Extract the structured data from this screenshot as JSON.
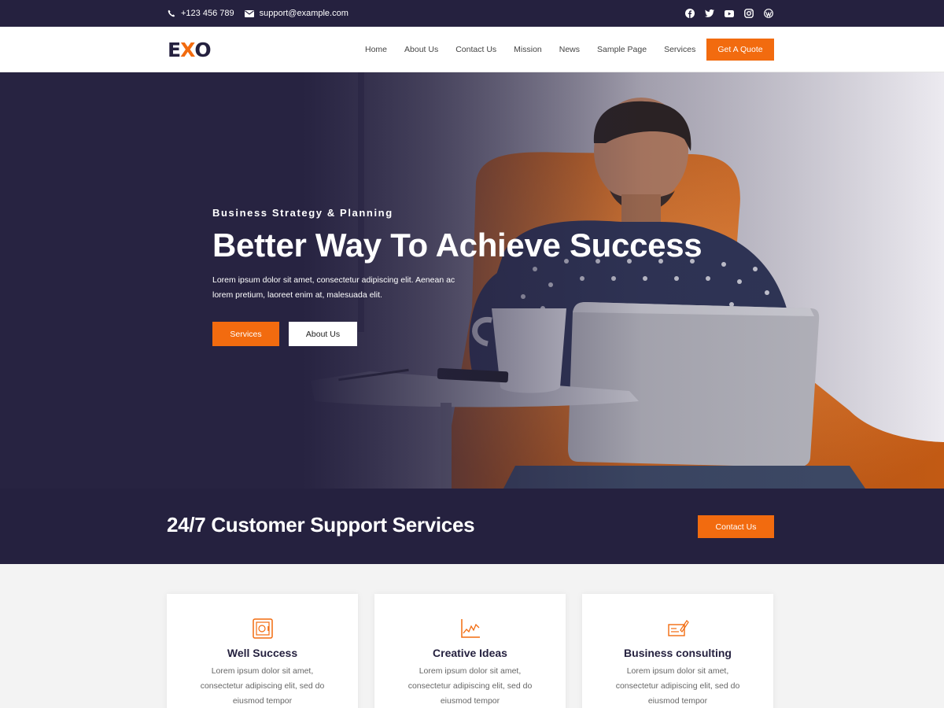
{
  "topbar": {
    "phone": "+123 456 789",
    "email": "support@example.com",
    "social_icons": [
      "facebook-icon",
      "twitter-icon",
      "youtube-icon",
      "instagram-icon",
      "wordpress-icon"
    ]
  },
  "header": {
    "logo_part1": "E",
    "logo_part2": "X",
    "logo_part3": "O",
    "nav": [
      "Home",
      "About Us",
      "Contact Us",
      "Mission",
      "News",
      "Sample Page",
      "Services"
    ],
    "cta": "Get A Quote"
  },
  "hero": {
    "subtitle": "Business Strategy & Planning",
    "title": "Better Way To Achieve Success",
    "description": "Lorem ipsum dolor sit amet, consectetur adipiscing elit. Aenean ac lorem pretium, laoreet enim at, malesuada elit.",
    "primary_button": "Services",
    "secondary_button": "About Us"
  },
  "support": {
    "title": "24/7 Customer Support Services",
    "button": "Contact Us"
  },
  "cards": [
    {
      "icon": "safe-icon",
      "title": "Well Success",
      "text": "Lorem ipsum dolor sit amet, consectetur adipiscing elit, sed do eiusmod tempor"
    },
    {
      "icon": "chart-icon",
      "title": "Creative Ideas",
      "text": "Lorem ipsum dolor sit amet, consectetur adipiscing elit, sed do eiusmod tempor"
    },
    {
      "icon": "cheque-icon",
      "title": "Business consulting",
      "text": "Lorem ipsum dolor sit amet, consectetur adipiscing elit, sed do eiusmod tempor"
    }
  ],
  "colors": {
    "navy": "#25213f",
    "accent": "#f26b0f",
    "white": "#ffffff",
    "light_bg": "#f3f3f3"
  }
}
